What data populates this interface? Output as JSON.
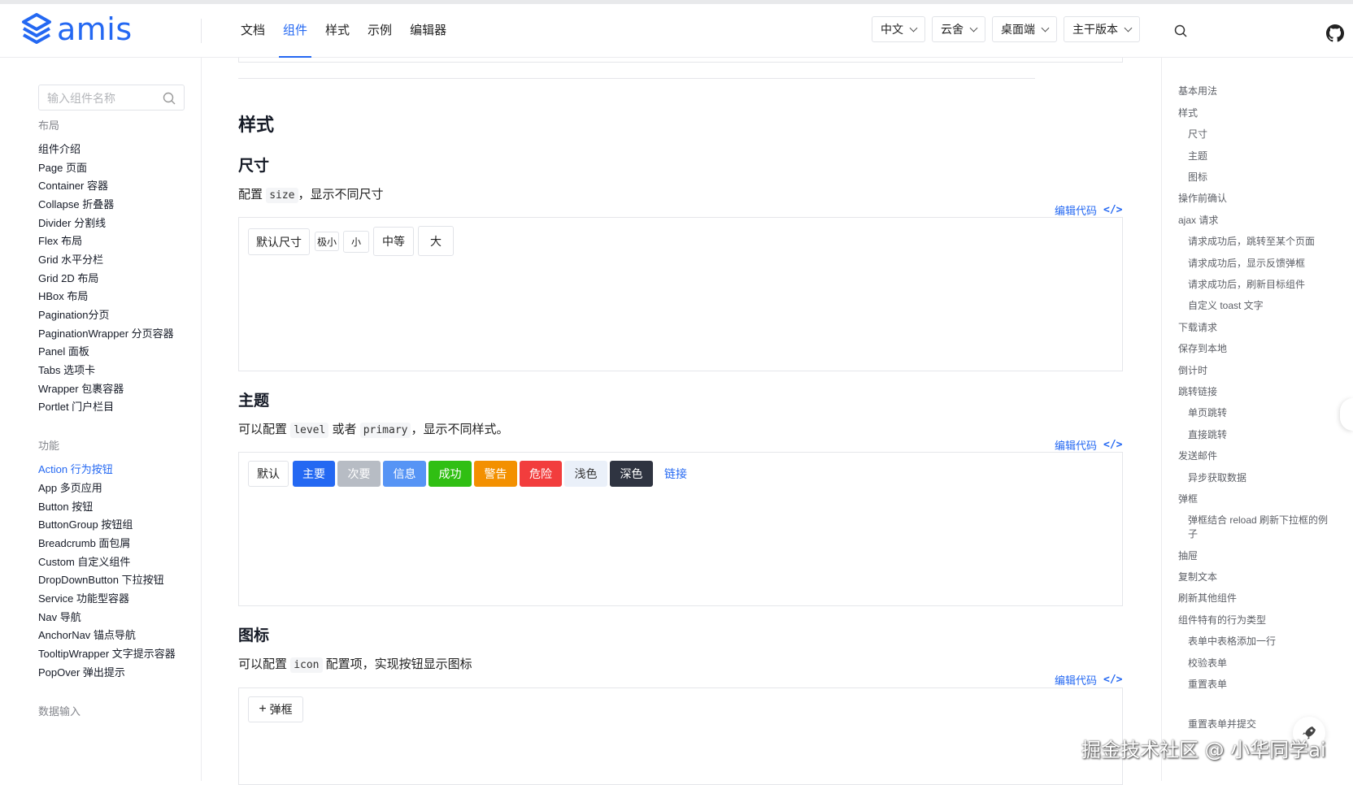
{
  "header": {
    "logo_text": "amis",
    "nav": [
      "文档",
      "组件",
      "样式",
      "示例",
      "编辑器"
    ],
    "nav_active": "组件",
    "selects": [
      "中文",
      "云舍",
      "桌面端",
      "主干版本"
    ],
    "brand_color": "#2468f2"
  },
  "sidebar": {
    "search_placeholder": "输入组件名称",
    "group_layout": "布局",
    "layout_items": [
      "组件介绍",
      "Page 页面",
      "Container 容器",
      "Collapse 折叠器",
      "Divider 分割线",
      "Flex 布局",
      "Grid 水平分栏",
      "Grid 2D 布局",
      "HBox 布局",
      "Pagination分页",
      "PaginationWrapper 分页容器",
      "Panel 面板",
      "Tabs 选项卡",
      "Wrapper 包裹容器",
      "Portlet 门户栏目"
    ],
    "group_function": "功能",
    "function_items": [
      "Action 行为按钮",
      "App 多页应用",
      "Button 按钮",
      "ButtonGroup 按钮组",
      "Breadcrumb 面包屑",
      "Custom 自定义组件",
      "DropDownButton 下拉按钮",
      "Service 功能型容器",
      "Nav 导航",
      "AnchorNav 锚点导航",
      "TooltipWrapper 文字提示容器",
      "PopOver 弹出提示"
    ],
    "function_active": "Action 行为按钮",
    "group_data_input": "数据输入"
  },
  "main": {
    "h1": "样式",
    "size_section": {
      "title": "尺寸",
      "desc_pre": "配置",
      "desc_code": "size",
      "desc_post": "，显示不同尺寸",
      "edit_label": "编辑代码",
      "edit_tag": "</>",
      "buttons": [
        "默认尺寸",
        "极小",
        "小",
        "中等",
        "大"
      ]
    },
    "theme_section": {
      "title": "主题",
      "desc_pre": "可以配置",
      "desc_code1": "level",
      "desc_mid": "或者",
      "desc_code2": "primary",
      "desc_post": "，显示不同样式。",
      "edit_label": "编辑代码",
      "edit_tag": "</>",
      "buttons": [
        "默认",
        "主要",
        "次要",
        "信息",
        "成功",
        "警告",
        "危险",
        "浅色",
        "深色",
        "链接"
      ]
    },
    "icon_section": {
      "title": "图标",
      "desc_pre": "可以配置",
      "desc_code": "icon",
      "desc_post": "配置项，实现按钮显示图标",
      "edit_label": "编辑代码",
      "edit_tag": "</>",
      "button_icon": "+",
      "button_label": "弹框"
    }
  },
  "toc": [
    "基本用法",
    "样式",
    "尺寸",
    "主题",
    "图标",
    "操作前确认",
    "ajax 请求",
    "请求成功后，跳转至某个页面",
    "请求成功后，显示反馈弹框",
    "请求成功后，刷新目标组件",
    "自定义 toast 文字",
    "下载请求",
    "保存到本地",
    "倒计时",
    "跳转链接",
    "单页跳转",
    "直接跳转",
    "发送邮件",
    "异步获取数据",
    "弹框",
    "弹框结合 reload 刷新下拉框的例",
    "子",
    "抽屉",
    "复制文本",
    "刷新其他组件",
    "组件特有的行为类型",
    "表单中表格添加一行",
    "校验表单",
    "重置表单",
    "重置表单并提交"
  ],
  "watermark": "掘金技术社区 @ 小华同学ai"
}
